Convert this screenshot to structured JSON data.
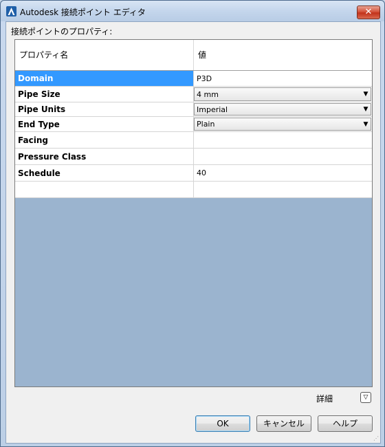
{
  "window": {
    "title": "Autodesk 接続ポイント エディタ",
    "close_label": "✕"
  },
  "section_label": "接続ポイントのプロパティ:",
  "grid": {
    "columns": [
      "プロパティ名",
      "値"
    ],
    "rows": [
      {
        "name": "Domain",
        "value": "P3D",
        "selected": true,
        "dropdown": false
      },
      {
        "name": "Pipe Size",
        "value": "4 mm",
        "selected": false,
        "dropdown": true
      },
      {
        "name": "Pipe Units",
        "value": "Imperial",
        "selected": false,
        "dropdown": true
      },
      {
        "name": "End Type",
        "value": "Plain",
        "selected": false,
        "dropdown": true
      },
      {
        "name": "Facing",
        "value": "",
        "selected": false,
        "dropdown": false
      },
      {
        "name": "Pressure Class",
        "value": "",
        "selected": false,
        "dropdown": false
      },
      {
        "name": "Schedule",
        "value": "40",
        "selected": false,
        "dropdown": false
      },
      {
        "name": "",
        "value": "",
        "selected": false,
        "dropdown": false
      }
    ]
  },
  "details_label": "詳細",
  "buttons": {
    "ok": "OK",
    "cancel": "キャンセル",
    "help": "ヘルプ"
  },
  "colors": {
    "selection": "#3399ff",
    "grid_background": "#9bb4cf"
  }
}
